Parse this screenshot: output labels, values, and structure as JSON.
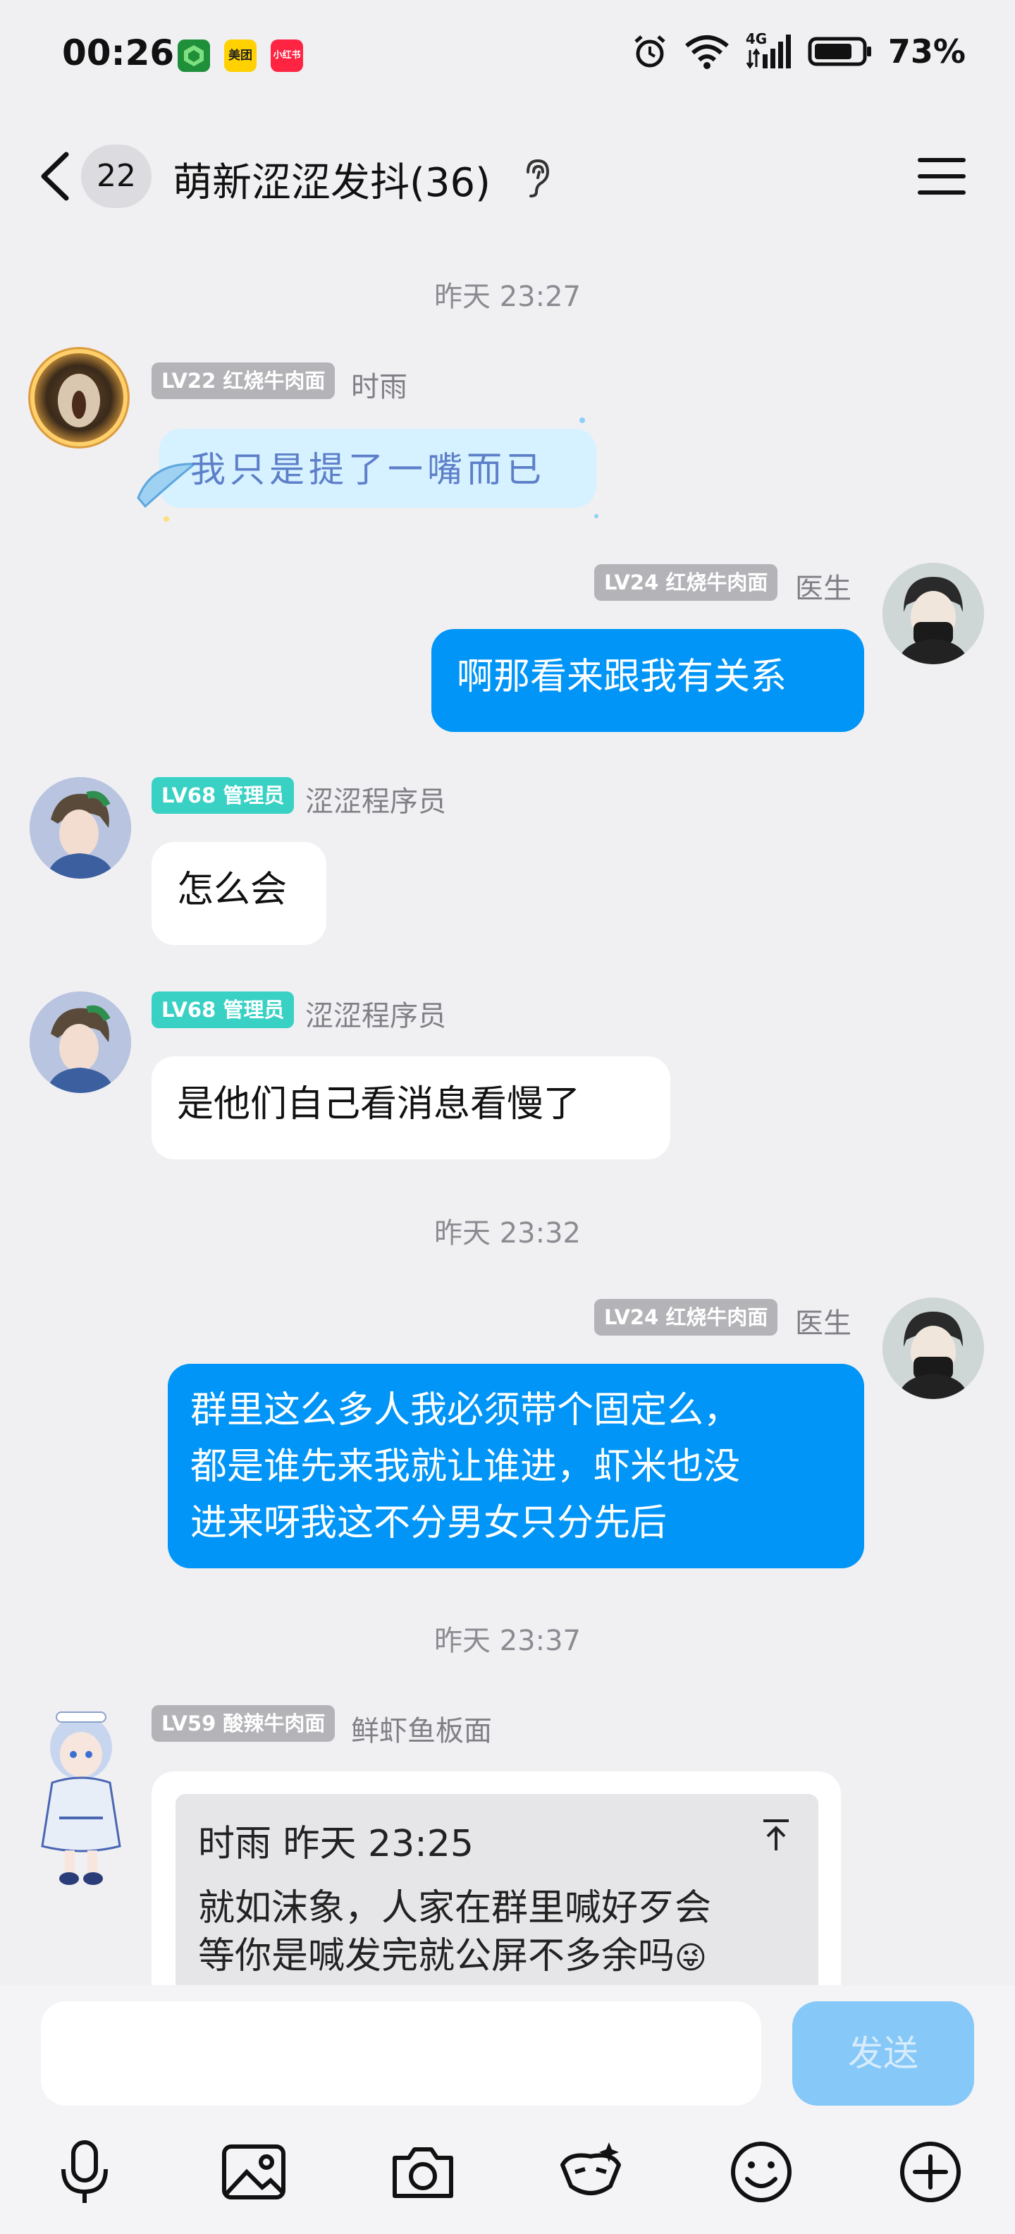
{
  "status_bar": {
    "time": "00:26",
    "apps": [
      {
        "name": "app-icon-green",
        "color": "#2bb24c",
        "label": ""
      },
      {
        "name": "meituan-icon",
        "color": "#ffd100",
        "label": "美团"
      },
      {
        "name": "xiaohongshu-icon",
        "color": "#ff2442",
        "label": "小红书"
      }
    ],
    "network": "4G",
    "battery": "73%"
  },
  "header": {
    "unread_count": "22",
    "title": "萌新涩涩发抖(36)"
  },
  "messages": {
    "time1": "昨天 23:27",
    "m1": {
      "level": "LV22 红烧牛肉面",
      "name": "时雨",
      "sticker_text": "我只是提了一嘴而已"
    },
    "m2": {
      "level": "LV24 红烧牛肉面",
      "name": "医生",
      "text": "啊那看来跟我有关系"
    },
    "m3": {
      "level": "LV68 管理员",
      "name": "涩涩程序员",
      "text": "怎么会"
    },
    "m4": {
      "level": "LV68 管理员",
      "name": "涩涩程序员",
      "text": "是他们自己看消息看慢了"
    },
    "time2": "昨天 23:32",
    "m5": {
      "level": "LV24 红烧牛肉面",
      "name": "医生",
      "lines": [
        "群里这么多人我必须带个固定么，",
        "都是谁先来我就让谁进，虾米也没",
        "进来呀我这不分男女只分先后"
      ]
    },
    "time3": "昨天 23:37",
    "m6": {
      "level": "LV59 酸辣牛肉面",
      "name": "鲜虾鱼板面",
      "quote_head": "时雨 昨天 23:25",
      "quote_lines": [
        "就如沫象，人家在群里喊好歹会",
        "等你是喊发完就公屏不多余吗"
      ],
      "quote_emoji": "😜"
    }
  },
  "input": {
    "placeholder": "",
    "send_label": "发送"
  },
  "colors": {
    "accent_blue": "#0095f6",
    "send_disabled": "#86c8f7",
    "admin_badge": "#38d1c4",
    "level_badge": "#b3b3b8"
  },
  "icons": [
    "back-icon",
    "ear-icon",
    "menu-icon",
    "voice-icon",
    "image-icon",
    "camera-icon",
    "sticker-icon",
    "emoji-icon",
    "plus-icon"
  ]
}
